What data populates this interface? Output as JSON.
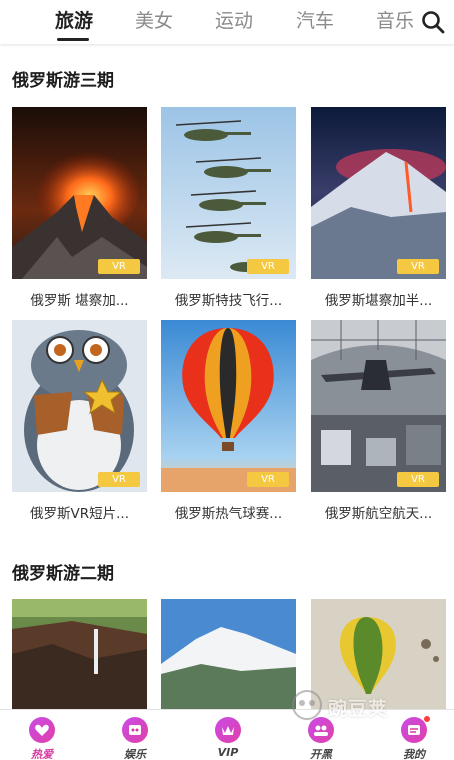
{
  "tabs": [
    {
      "label": "旅游",
      "active": true
    },
    {
      "label": "美女",
      "active": false
    },
    {
      "label": "运动",
      "active": false
    },
    {
      "label": "汽车",
      "active": false
    },
    {
      "label": "音乐",
      "active": false
    }
  ],
  "sections": [
    {
      "title": "俄罗斯游三期",
      "cards": [
        {
          "caption": "俄罗斯 堪察加...",
          "badge": "VR",
          "image": "erupting-volcano"
        },
        {
          "caption": "俄罗斯特技飞行...",
          "badge": "VR",
          "image": "helicopters"
        },
        {
          "caption": "俄罗斯堪察加半...",
          "badge": "VR",
          "image": "volcano-at-night"
        },
        {
          "caption": "俄罗斯VR短片...",
          "badge": "VR",
          "image": "cartoon-owl-sheriff"
        },
        {
          "caption": "俄罗斯热气球赛...",
          "badge": "VR",
          "image": "hot-air-balloon"
        },
        {
          "caption": "俄罗斯航空航天...",
          "badge": "VR",
          "image": "aviation-museum"
        }
      ]
    },
    {
      "title": "俄罗斯游二期",
      "cards": [
        {
          "caption": "",
          "badge": "",
          "image": "canyon-waterfall"
        },
        {
          "caption": "",
          "badge": "",
          "image": "snowy-mountain"
        },
        {
          "caption": "",
          "badge": "",
          "image": "balloons"
        }
      ]
    }
  ],
  "bottom_nav": [
    {
      "label": "热爱",
      "icon": "heart-hand-icon",
      "active": true
    },
    {
      "label": "娱乐",
      "icon": "game-icon",
      "active": false
    },
    {
      "label": "VIP",
      "icon": "vip-icon",
      "active": false
    },
    {
      "label": "开黑",
      "icon": "team-icon",
      "active": false
    },
    {
      "label": "我的",
      "icon": "profile-icon",
      "active": false
    }
  ],
  "watermark": "豌豆荚",
  "colors": {
    "accent": "#d63aa0",
    "badge": "#f5c842"
  }
}
